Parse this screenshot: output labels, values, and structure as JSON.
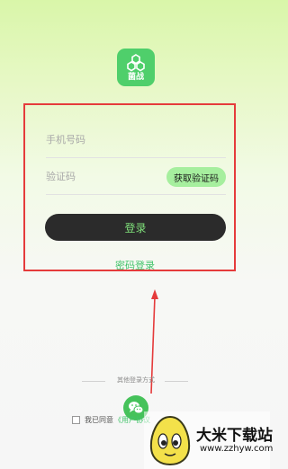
{
  "app": {
    "logo_text": "菌战"
  },
  "login_form": {
    "phone_placeholder": "手机号码",
    "code_placeholder": "验证码",
    "get_code_label": "获取验证码",
    "login_label": "登录",
    "password_login_label": "密码登录"
  },
  "other_login": {
    "label": "其他登录方式",
    "options": [
      "wechat-icon"
    ]
  },
  "agreement": {
    "prefix": "我已同意",
    "link": "《用户协议"
  },
  "watermark": {
    "title": "大米下载站",
    "url": "www.zzhyw.com"
  },
  "colors": {
    "accent_green": "#41c36a",
    "login_button": "#2b2b2b",
    "annotation_red": "#e53b3b"
  }
}
